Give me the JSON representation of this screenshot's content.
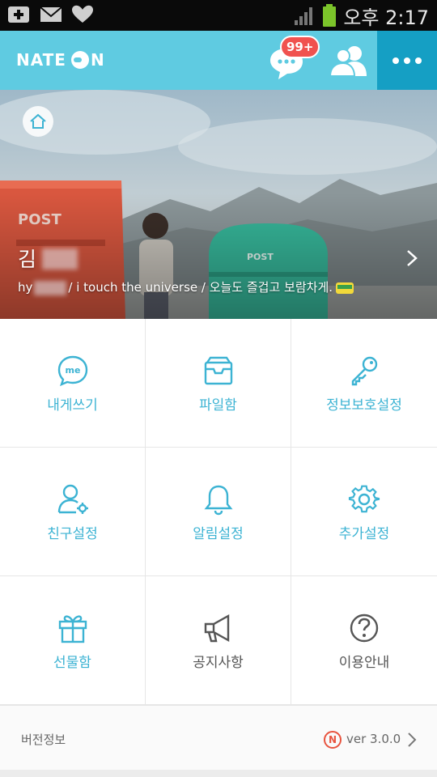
{
  "status_bar": {
    "time": "오후 2:17",
    "icons": [
      "add-notification-icon",
      "mail-icon",
      "heart-icon",
      "signal-icon",
      "battery-icon"
    ]
  },
  "header": {
    "logo_text_left": "NATE",
    "logo_text_right": "N",
    "chat_badge": "99+",
    "icons": [
      "chat-icon",
      "friends-icon",
      "more-icon"
    ],
    "colors": {
      "header_bg": "#5fcbe1",
      "more_bg": "#159fc4",
      "badge": "#f0524f"
    }
  },
  "profile": {
    "name_visible": "김",
    "status_prefix": "hy",
    "status_text": "/ i touch the universe / 오늘도 즐겁고 보람차게."
  },
  "menu": {
    "items": [
      {
        "label": "내게쓰기",
        "icon": "me-icon"
      },
      {
        "label": "파일함",
        "icon": "inbox-icon"
      },
      {
        "label": "정보보호설정",
        "icon": "key-icon"
      },
      {
        "label": "친구설정",
        "icon": "friend-settings-icon"
      },
      {
        "label": "알림설정",
        "icon": "bell-icon"
      },
      {
        "label": "추가설정",
        "icon": "gear-icon"
      },
      {
        "label": "선물함",
        "icon": "gift-icon"
      },
      {
        "label": "공지사항",
        "icon": "megaphone-icon"
      },
      {
        "label": "이용안내",
        "icon": "help-icon"
      }
    ],
    "colors": {
      "accent": "#3cb3d3",
      "muted": "#555555"
    }
  },
  "version": {
    "label": "버전정보",
    "badge": "N",
    "value": "ver 3.0.0"
  }
}
